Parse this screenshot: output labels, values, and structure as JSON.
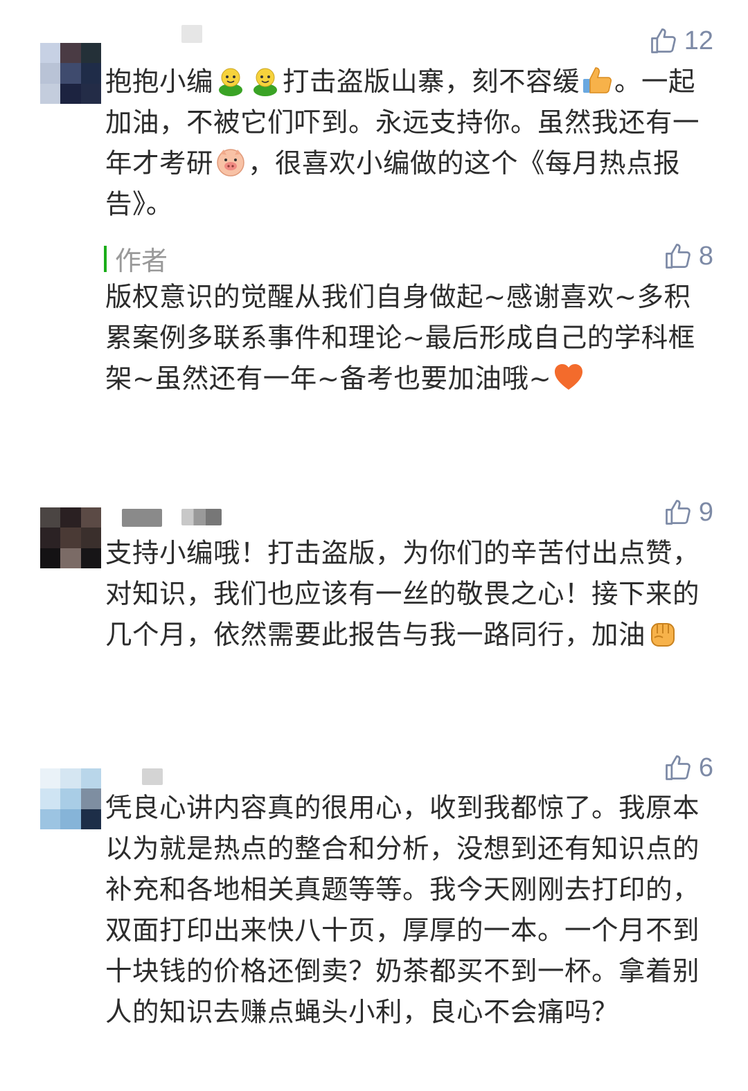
{
  "comments": [
    {
      "likes": "12",
      "text_parts": [
        "抱抱小编",
        "打击盗版山寨，刻不容缓",
        "。一起加油，不被它们吓到。永远支持你。虽然我还有一年才考研",
        "，很喜欢小编做的这个《每月热点报告》。"
      ],
      "emojis": [
        "green-person-emoji",
        "thumbs-up-emoji",
        "pig-emoji"
      ],
      "reply": {
        "author_label": "作者",
        "likes": "8",
        "text": "版权意识的觉醒从我们自身做起~感谢喜欢~多积累案例多联系事件和理论~最后形成自己的学科框架~虽然还有一年~备考也要加油哦~",
        "emojis": [
          "heart-emoji"
        ]
      }
    },
    {
      "likes": "9",
      "text": "支持小编哦！打击盗版，为你们的辛苦付出点赞，对知识，我们也应该有一丝的敬畏之心！接下来的几个月，依然需要此报告与我一路同行，加油",
      "emojis": [
        "fist-emoji"
      ]
    },
    {
      "likes": "6",
      "text": "凭良心讲内容真的很用心，收到我都惊了。我原本以为就是热点的整合和分析，没想到还有知识点的补充和各地相关真题等等。我今天刚刚去打印的，双面打印出来快八十页，厚厚的一本。一个月不到十块钱的价格还倒卖？奶茶都买不到一杯。拿着别人的知识去赚点蝇头小利，良心不会痛吗？"
    }
  ],
  "colors": {
    "text": "#2c2c2c",
    "like": "#7d8aa6",
    "author_bar": "#1aad19",
    "author_label": "#999999"
  }
}
